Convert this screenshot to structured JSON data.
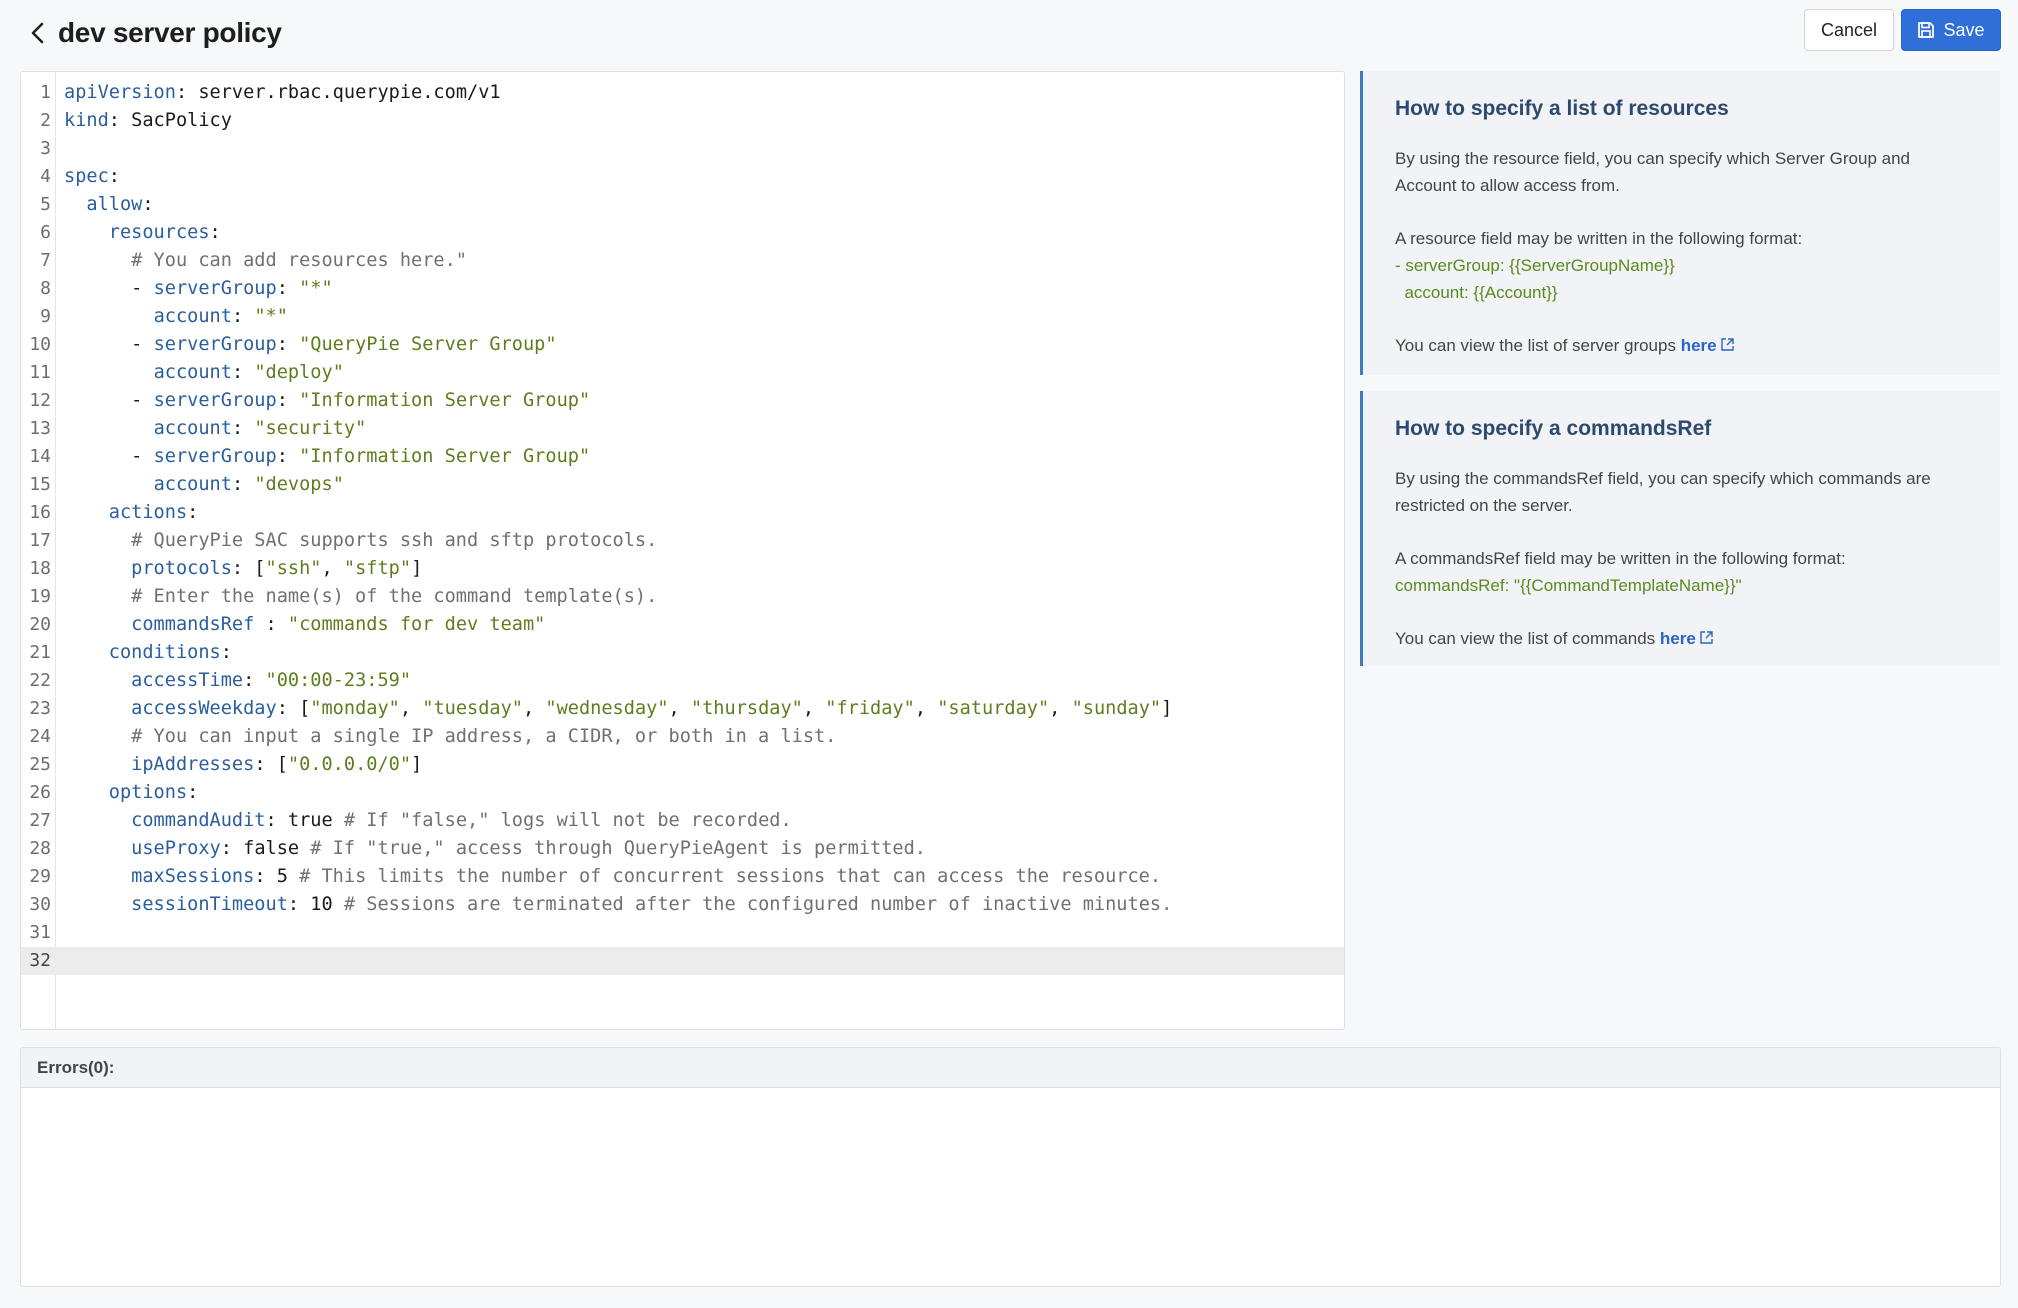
{
  "header": {
    "title": "dev server policy",
    "cancel_label": "Cancel",
    "save_label": "Save"
  },
  "icons": {
    "back": "chevron-left-icon",
    "save": "floppy-disk-icon",
    "external": "external-link-icon"
  },
  "colors": {
    "primary": "#2f6fd8",
    "key": "#2a5e9c",
    "string": "#5f7d1e",
    "comment": "#707070",
    "help_title": "#2c4a6e",
    "help_border": "#3f7ac0"
  },
  "editor": {
    "active_line": 32,
    "lines": [
      "apiVersion: server.rbac.querypie.com/v1",
      "kind: SacPolicy",
      "",
      "spec:",
      "  allow:",
      "    resources:",
      "      # You can add resources here.\"",
      "      - serverGroup: \"*\"",
      "        account: \"*\"",
      "      - serverGroup: \"QueryPie Server Group\"",
      "        account: \"deploy\"",
      "      - serverGroup: \"Information Server Group\"",
      "        account: \"security\"",
      "      - serverGroup: \"Information Server Group\"",
      "        account: \"devops\"",
      "    actions:",
      "      # QueryPie SAC supports ssh and sftp protocols.",
      "      protocols: [\"ssh\", \"sftp\"]",
      "      # Enter the name(s) of the command template(s).",
      "      commandsRef : \"commands for dev team\"",
      "    conditions:",
      "      accessTime: \"00:00-23:59\"",
      "      accessWeekday: [\"monday\", \"tuesday\", \"wednesday\", \"thursday\", \"friday\", \"saturday\", \"sunday\"]",
      "      # You can input a single IP address, a CIDR, or both in a list.",
      "      ipAddresses: [\"0.0.0.0/0\"]",
      "    options:",
      "      commandAudit: true # If \"false,\" logs will not be recorded.",
      "      useProxy: false # If \"true,\" access through QueryPieAgent is permitted.",
      "      maxSessions: 5 # This limits the number of concurrent sessions that can access the resource.",
      "      sessionTimeout: 10 # Sessions are terminated after the configured number of inactive minutes.",
      "",
      ""
    ]
  },
  "help": {
    "resources": {
      "title": "How to specify a list of resources",
      "desc": "By using the resource field, you can specify which Server Group and Account to allow access from.",
      "format_intro": "A resource field may be written in the following format:",
      "format_line1": "- serverGroup: {{ServerGroupName}}",
      "format_line2": "  account: {{Account}}",
      "link_prefix": "You can view the list of server groups",
      "link_label": "here"
    },
    "commands": {
      "title": "How to specify a commandsRef",
      "desc": "By using the commandsRef field, you can specify which commands are restricted on the server.",
      "format_intro": "A commandsRef field may be written in the following format:",
      "format_line1": "commandsRef: \"{{CommandTemplateName}}\"",
      "link_prefix": "You can view the list of commands",
      "link_label": "here"
    }
  },
  "errors": {
    "label": "Errors(0):"
  }
}
